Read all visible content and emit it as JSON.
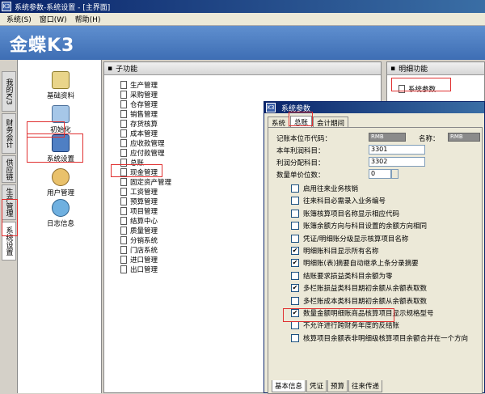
{
  "window": {
    "title": "系统参数-系统设置 - [主界面]",
    "icon_text": "K3"
  },
  "menu": {
    "items": [
      "系统(S)",
      "窗口(W)",
      "帮助(H)"
    ]
  },
  "brand": {
    "logo": "金蝶K3"
  },
  "leftnav": {
    "items": [
      "我的K/3",
      "财务会计",
      "供应链",
      "生产管理",
      "系统设置"
    ]
  },
  "modules": {
    "items": [
      "基础资料",
      "初始化",
      "系统设置",
      "用户管理",
      "日志信息"
    ]
  },
  "subfunc": {
    "header": "子功能",
    "items": [
      "生产管理",
      "采购管理",
      "仓存管理",
      "销售管理",
      "存货核算",
      "成本管理",
      "应收款管理",
      "应付款管理",
      "总账",
      "现金管理",
      "固定资产管理",
      "工资管理",
      "预算管理",
      "项目管理",
      "结算中心",
      "质量管理",
      "分销系统",
      "门店系统",
      "进口管理",
      "出口管理"
    ]
  },
  "detail": {
    "header": "明细功能",
    "item": "系统参数"
  },
  "dialog": {
    "title": "系统参数",
    "tabs": [
      "系统",
      "总账",
      "会计期间"
    ],
    "fields": {
      "currency_label": "记账本位币代码：",
      "currency_value": "RMB",
      "name_label": "名称：",
      "name_value": "RMB",
      "profit_label": "本年利润科目：",
      "profit_value": "3301",
      "dist_label": "利润分配科目：",
      "dist_value": "3302",
      "decimals_label": "数量单价位数：",
      "decimals_value": "0"
    },
    "options": [
      {
        "label": "启用往来业务核销",
        "checked": false
      },
      {
        "label": "往来科目必需录入业务编号",
        "checked": false
      },
      {
        "label": "账簿核算项目名称显示相应代码",
        "checked": false
      },
      {
        "label": "账簿余额方向与科目设置的余额方向相同",
        "checked": false
      },
      {
        "label": "凭证/明细账分级显示核算项目名称",
        "checked": false
      },
      {
        "label": "明细账科目显示所有名称",
        "checked": true
      },
      {
        "label": "明细账(表)摘要自动继承上条分录摘要",
        "checked": true
      },
      {
        "label": "结账要求损益类科目余额为零",
        "checked": false
      },
      {
        "label": "多栏账损益类科目期初余额从余额表取数",
        "checked": true
      },
      {
        "label": "多栏账成本类科目期初余额从余额表取数",
        "checked": false
      },
      {
        "label": "数量金额明细账商品核算项目显示规格型号",
        "checked": true
      },
      {
        "label": "不允许进行跨财务年度的反结账",
        "checked": false
      },
      {
        "label": "核算项目余额表非明细级核算项目余额合并在一个方向",
        "checked": false
      }
    ],
    "bottom_tabs": [
      "基本信息",
      "凭证",
      "预算",
      "往来传递"
    ]
  },
  "colors": {
    "title_bar": "#0a246a",
    "banner": "#4a7bc0",
    "highlight": "#e03030"
  }
}
